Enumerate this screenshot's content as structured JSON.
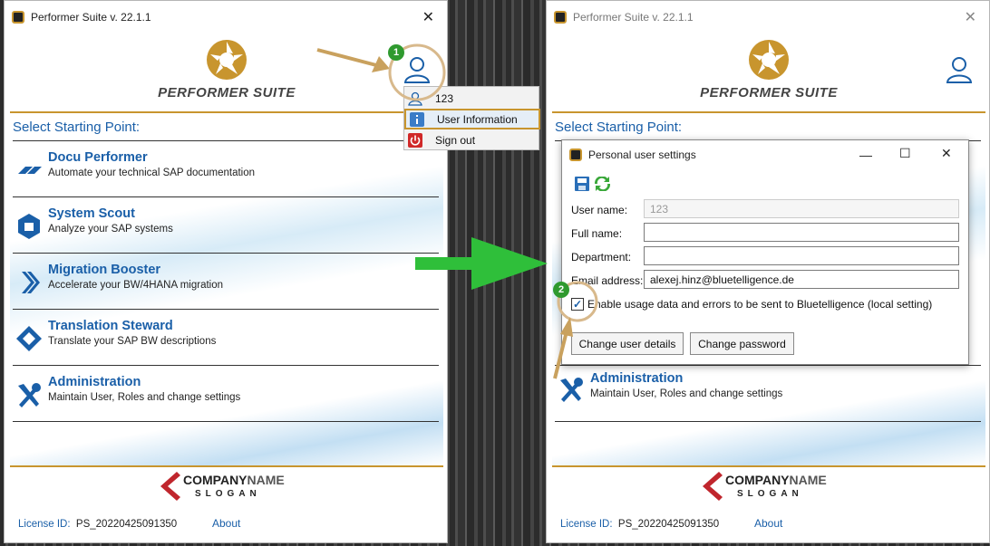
{
  "left_window": {
    "title": "Performer Suite v. 22.1.1",
    "logo_text": "PERFORMER SUITE",
    "select_label": "Select Starting Point:",
    "items": [
      {
        "name": "Docu Performer",
        "desc": "Automate your technical SAP documentation",
        "icon": "docu-performer-icon"
      },
      {
        "name": "System Scout",
        "desc": "Analyze your SAP systems",
        "icon": "system-scout-icon"
      },
      {
        "name": "Migration Booster",
        "desc": "Accelerate your BW/4HANA migration",
        "icon": "migration-booster-icon"
      },
      {
        "name": "Translation Steward",
        "desc": "Translate your SAP BW descriptions",
        "icon": "translation-steward-icon"
      },
      {
        "name": "Administration",
        "desc": "Maintain User, Roles and change settings",
        "icon": "administration-icon"
      }
    ],
    "company_name_1": "COMPANY",
    "company_name_2": "NAME",
    "company_slogan": "SLOGAN",
    "license_label": "License ID:",
    "license_id": "PS_20220425091350",
    "about": "About"
  },
  "user_menu": {
    "items": [
      {
        "label": "123",
        "icon": "user-icon"
      },
      {
        "label": "User Information",
        "icon": "info-icon"
      },
      {
        "label": "Sign out",
        "icon": "power-icon"
      }
    ]
  },
  "right_window": {
    "title": "Performer Suite v. 22.1.1",
    "logo_text": "PERFORMER SUITE",
    "select_label": "Select Starting Point:",
    "admin_name": "Administration",
    "admin_desc": "Maintain User, Roles and change settings",
    "company_name_1": "COMPANY",
    "company_name_2": "NAME",
    "company_slogan": "SLOGAN",
    "license_label": "License ID:",
    "license_id": "PS_20220425091350",
    "about": "About"
  },
  "dialog": {
    "title": "Personal user settings",
    "labels": {
      "user_name": "User name:",
      "full_name": "Full name:",
      "department": "Department:",
      "email": "Email address:"
    },
    "values": {
      "user_name": "123",
      "full_name": "",
      "department": "",
      "email": "alexej.hinz@bluetelligence.de"
    },
    "checkbox_label": "Enable usage data and errors to be sent to Bluetelligence (local setting)",
    "checkbox_checked": "✓",
    "change_details": "Change user details",
    "change_password": "Change password"
  },
  "annotations": {
    "badge1": "1",
    "badge2": "2"
  },
  "colors": {
    "brand_blue": "#1a5fa8",
    "gold": "#c8952e",
    "green_arrow": "#2fbf3a",
    "tan_arrow": "#c9a15e"
  }
}
